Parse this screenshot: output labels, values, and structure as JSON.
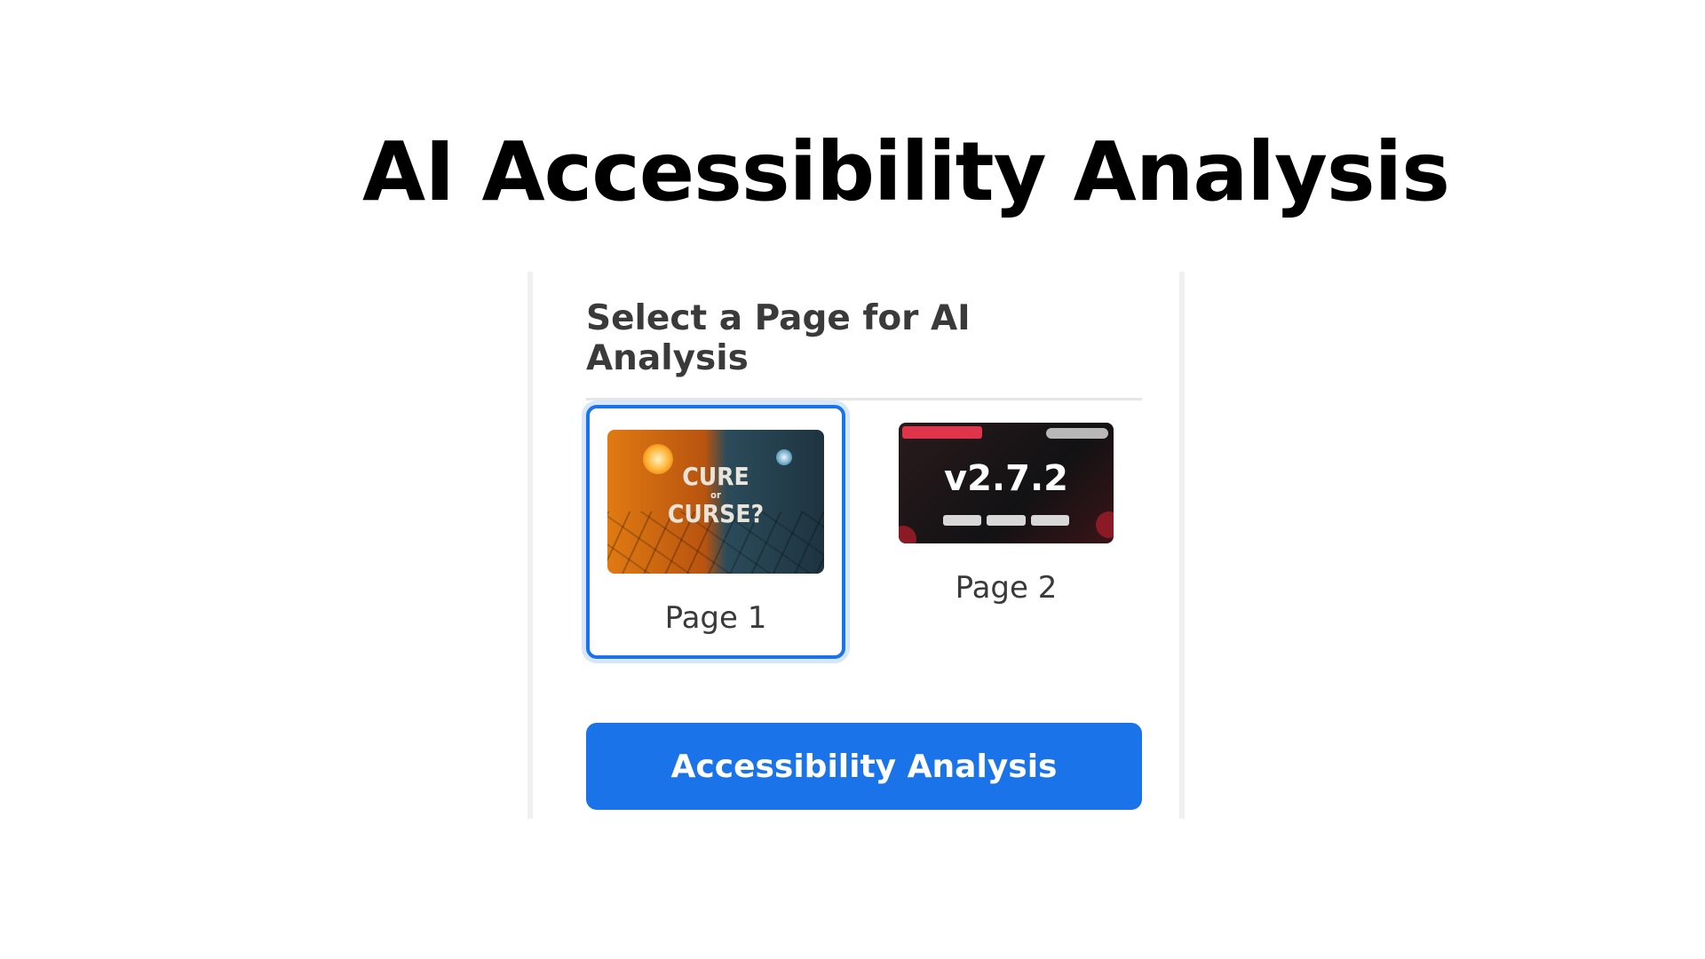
{
  "header": {
    "title": "AI Accessibility Analysis"
  },
  "panel": {
    "heading": "Select a Page for AI Analysis",
    "pages": [
      {
        "label": "Page 1",
        "selected": true,
        "thumbnail_text": [
          "CURE",
          "or",
          "CURSE?"
        ]
      },
      {
        "label": "Page 2",
        "selected": false,
        "thumbnail_text": [
          "v2.7.2"
        ]
      }
    ],
    "action_button_label": "Accessibility Analysis"
  },
  "colors": {
    "accent": "#1a73e8",
    "selected_ring": "#d6e6fb",
    "text_dark": "#3a3a3a"
  }
}
